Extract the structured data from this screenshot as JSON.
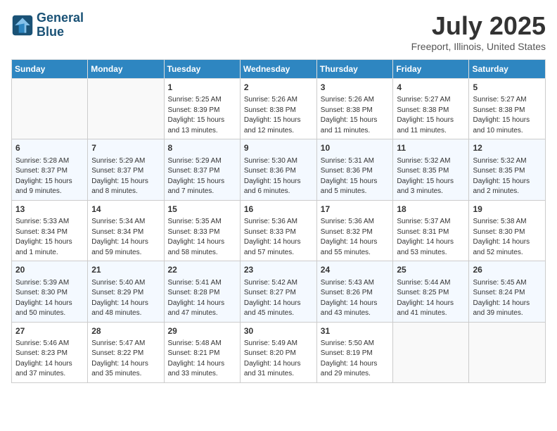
{
  "header": {
    "logo_line1": "General",
    "logo_line2": "Blue",
    "month_title": "July 2025",
    "location": "Freeport, Illinois, United States"
  },
  "weekdays": [
    "Sunday",
    "Monday",
    "Tuesday",
    "Wednesday",
    "Thursday",
    "Friday",
    "Saturday"
  ],
  "weeks": [
    [
      null,
      null,
      {
        "day": 1,
        "sunrise": "5:25 AM",
        "sunset": "8:39 PM",
        "daylight": "15 hours and 13 minutes."
      },
      {
        "day": 2,
        "sunrise": "5:26 AM",
        "sunset": "8:38 PM",
        "daylight": "15 hours and 12 minutes."
      },
      {
        "day": 3,
        "sunrise": "5:26 AM",
        "sunset": "8:38 PM",
        "daylight": "15 hours and 11 minutes."
      },
      {
        "day": 4,
        "sunrise": "5:27 AM",
        "sunset": "8:38 PM",
        "daylight": "15 hours and 11 minutes."
      },
      {
        "day": 5,
        "sunrise": "5:27 AM",
        "sunset": "8:38 PM",
        "daylight": "15 hours and 10 minutes."
      }
    ],
    [
      {
        "day": 6,
        "sunrise": "5:28 AM",
        "sunset": "8:37 PM",
        "daylight": "15 hours and 9 minutes."
      },
      {
        "day": 7,
        "sunrise": "5:29 AM",
        "sunset": "8:37 PM",
        "daylight": "15 hours and 8 minutes."
      },
      {
        "day": 8,
        "sunrise": "5:29 AM",
        "sunset": "8:37 PM",
        "daylight": "15 hours and 7 minutes."
      },
      {
        "day": 9,
        "sunrise": "5:30 AM",
        "sunset": "8:36 PM",
        "daylight": "15 hours and 6 minutes."
      },
      {
        "day": 10,
        "sunrise": "5:31 AM",
        "sunset": "8:36 PM",
        "daylight": "15 hours and 5 minutes."
      },
      {
        "day": 11,
        "sunrise": "5:32 AM",
        "sunset": "8:35 PM",
        "daylight": "15 hours and 3 minutes."
      },
      {
        "day": 12,
        "sunrise": "5:32 AM",
        "sunset": "8:35 PM",
        "daylight": "15 hours and 2 minutes."
      }
    ],
    [
      {
        "day": 13,
        "sunrise": "5:33 AM",
        "sunset": "8:34 PM",
        "daylight": "15 hours and 1 minute."
      },
      {
        "day": 14,
        "sunrise": "5:34 AM",
        "sunset": "8:34 PM",
        "daylight": "14 hours and 59 minutes."
      },
      {
        "day": 15,
        "sunrise": "5:35 AM",
        "sunset": "8:33 PM",
        "daylight": "14 hours and 58 minutes."
      },
      {
        "day": 16,
        "sunrise": "5:36 AM",
        "sunset": "8:33 PM",
        "daylight": "14 hours and 57 minutes."
      },
      {
        "day": 17,
        "sunrise": "5:36 AM",
        "sunset": "8:32 PM",
        "daylight": "14 hours and 55 minutes."
      },
      {
        "day": 18,
        "sunrise": "5:37 AM",
        "sunset": "8:31 PM",
        "daylight": "14 hours and 53 minutes."
      },
      {
        "day": 19,
        "sunrise": "5:38 AM",
        "sunset": "8:30 PM",
        "daylight": "14 hours and 52 minutes."
      }
    ],
    [
      {
        "day": 20,
        "sunrise": "5:39 AM",
        "sunset": "8:30 PM",
        "daylight": "14 hours and 50 minutes."
      },
      {
        "day": 21,
        "sunrise": "5:40 AM",
        "sunset": "8:29 PM",
        "daylight": "14 hours and 48 minutes."
      },
      {
        "day": 22,
        "sunrise": "5:41 AM",
        "sunset": "8:28 PM",
        "daylight": "14 hours and 47 minutes."
      },
      {
        "day": 23,
        "sunrise": "5:42 AM",
        "sunset": "8:27 PM",
        "daylight": "14 hours and 45 minutes."
      },
      {
        "day": 24,
        "sunrise": "5:43 AM",
        "sunset": "8:26 PM",
        "daylight": "14 hours and 43 minutes."
      },
      {
        "day": 25,
        "sunrise": "5:44 AM",
        "sunset": "8:25 PM",
        "daylight": "14 hours and 41 minutes."
      },
      {
        "day": 26,
        "sunrise": "5:45 AM",
        "sunset": "8:24 PM",
        "daylight": "14 hours and 39 minutes."
      }
    ],
    [
      {
        "day": 27,
        "sunrise": "5:46 AM",
        "sunset": "8:23 PM",
        "daylight": "14 hours and 37 minutes."
      },
      {
        "day": 28,
        "sunrise": "5:47 AM",
        "sunset": "8:22 PM",
        "daylight": "14 hours and 35 minutes."
      },
      {
        "day": 29,
        "sunrise": "5:48 AM",
        "sunset": "8:21 PM",
        "daylight": "14 hours and 33 minutes."
      },
      {
        "day": 30,
        "sunrise": "5:49 AM",
        "sunset": "8:20 PM",
        "daylight": "14 hours and 31 minutes."
      },
      {
        "day": 31,
        "sunrise": "5:50 AM",
        "sunset": "8:19 PM",
        "daylight": "14 hours and 29 minutes."
      },
      null,
      null
    ]
  ]
}
